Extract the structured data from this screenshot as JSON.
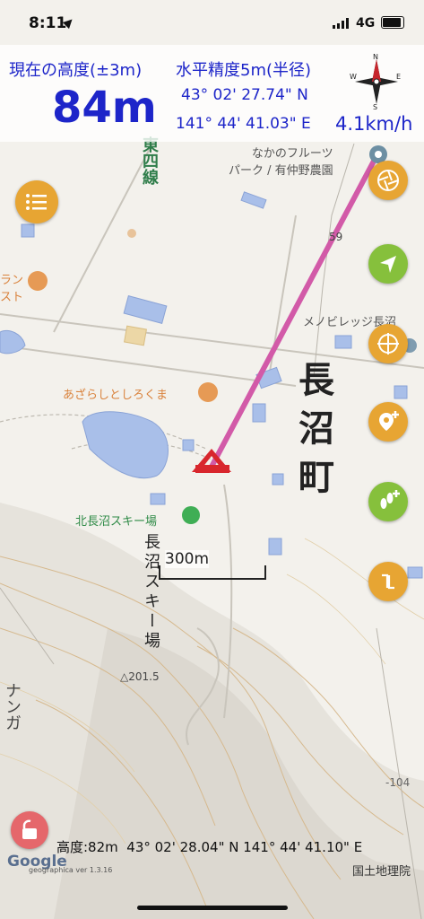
{
  "status_bar": {
    "time": "8:11",
    "network": "4G"
  },
  "hud": {
    "altitude_label": "現在の高度(±3m)",
    "altitude_value": "84m",
    "accuracy_label": "水平精度5m(半径)",
    "lat": "43° 02' 27.74\" N",
    "lon": "141° 44' 41.03\" E",
    "speed": "4.1km/h",
    "compass_letters": [
      "N",
      "S",
      "E",
      "W"
    ]
  },
  "map": {
    "labels": {
      "farm": "なかのフルーツ\nパーク / 有仲野農園",
      "road_line": "東四線",
      "restaurant": "ラン\nスト",
      "asaraku": "あざらしとしろくま",
      "village": "メノビレッジ長沼",
      "ski_area": "北長沼スキー場",
      "town": "長沼町",
      "ski_vertical": "長沼スキー場",
      "elev_201": "△201.5",
      "elev_104": "-104",
      "route_59": "59",
      "left_vertical": "ナンガ",
      "scale": "300m"
    }
  },
  "buttons": {
    "menu": "menu",
    "layers": "layers",
    "navigate": "navigate",
    "compass": "compass",
    "add_location": "add-location",
    "add_footprint": "add-footprint",
    "route": "route",
    "lock": "lock"
  },
  "bottom": {
    "text": "高度:82m  43° 02' 28.04\" N 141° 44' 41.10\" E",
    "google": "Google",
    "version": "geographica ver 1.3.16",
    "gsi": "国土地理院"
  },
  "colors": {
    "hud_text": "#1d25c9",
    "orange_button": "#e7a533",
    "green_button": "#86c03c",
    "track": "#d25aa8"
  }
}
